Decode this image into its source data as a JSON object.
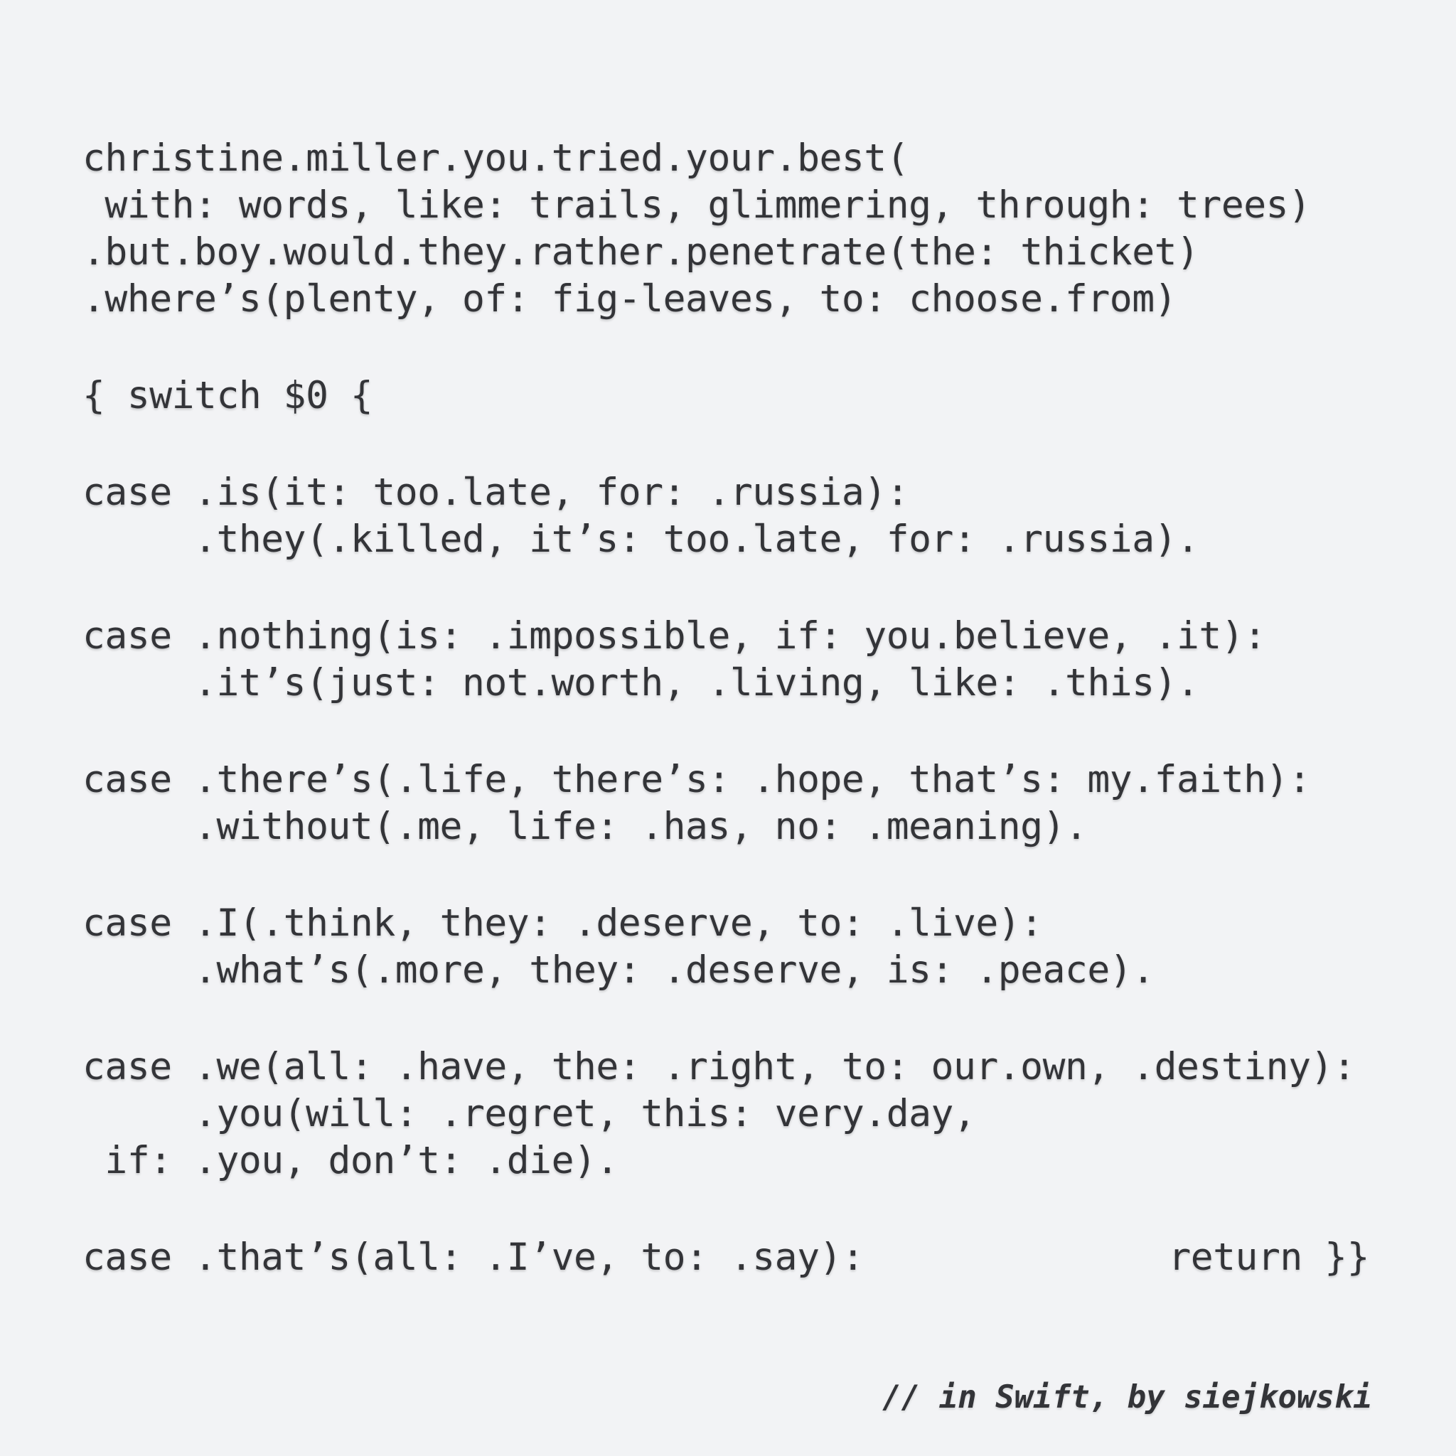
{
  "code": {
    "intro": [
      "christine.miller.you.tried.your.best(",
      " with: words, like: trails, glimmering, through: trees)",
      ".but.boy.would.they.rather.penetrate(the: thicket)",
      ".where’s(plenty, of: fig-leaves, to: choose.from)"
    ],
    "switch_open": "{ switch $0 {",
    "cases": [
      {
        "line1": "case .is(it: too.late, for: .russia):",
        "line2": "     .they(.killed, it’s: too.late, for: .russia)."
      },
      {
        "line1": "case .nothing(is: .impossible, if: you.believe, .it):",
        "line2": "     .it’s(just: not.worth, .living, like: .this)."
      },
      {
        "line1": "case .there’s(.life, there’s: .hope, that’s: my.faith):",
        "line2": "     .without(.me, life: .has, no: .meaning)."
      },
      {
        "line1": "case .I(.think, they: .deserve, to: .live):",
        "line2": "     .what’s(.more, they: .deserve, is: .peace)."
      },
      {
        "line1": "case .we(all: .have, the: .right, to: our.own, .destiny):",
        "line2": "     .you(will: .regret, this: very.day,",
        "line3": " if: .you, don’t: .die)."
      }
    ],
    "final_case": "case .that’s(all: .I’ve, to: .say):",
    "final_return": "return }}"
  },
  "credit": "// in Swift, by siejkowski"
}
